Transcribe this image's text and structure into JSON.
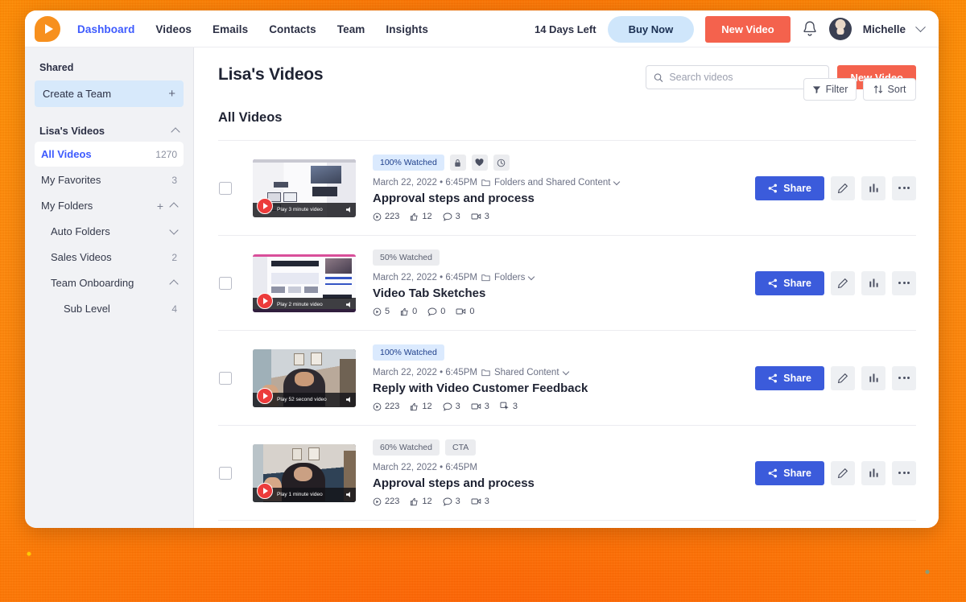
{
  "topnav": {
    "logo": "vidyard-play-logo",
    "links": [
      {
        "label": "Dashboard",
        "active": true
      },
      {
        "label": "Videos",
        "active": false
      },
      {
        "label": "Emails",
        "active": false
      },
      {
        "label": "Contacts",
        "active": false
      },
      {
        "label": "Team",
        "active": false
      },
      {
        "label": "Insights",
        "active": false
      }
    ],
    "days_left": "14 Days Left",
    "buy_now": "Buy Now",
    "new_video": "New Video",
    "user_name": "Michelle"
  },
  "sidebar": {
    "shared_heading": "Shared",
    "create_team": "Create a Team",
    "group_label": "Lisa's Videos",
    "items": [
      {
        "label": "All Videos",
        "count": "1270",
        "selected": true,
        "indent": 0
      },
      {
        "label": "My Favorites",
        "count": "3",
        "selected": false,
        "indent": 0
      },
      {
        "label": "My Folders",
        "count": "",
        "selected": false,
        "indent": 0
      },
      {
        "label": "Auto Folders",
        "count": "",
        "selected": false,
        "indent": 1
      },
      {
        "label": "Sales Videos",
        "count": "2",
        "selected": false,
        "indent": 1
      },
      {
        "label": "Team Onboarding",
        "count": "",
        "selected": false,
        "indent": 1
      },
      {
        "label": "Sub Level",
        "count": "4",
        "selected": false,
        "indent": 2
      }
    ]
  },
  "main": {
    "page_title": "Lisa's Videos",
    "section_title": "All Videos",
    "search_placeholder": "Search videos",
    "search_value": "",
    "new_video_button": "New Video",
    "filter_button": "Filter",
    "sort_button": "Sort",
    "share_label": "Share"
  },
  "colors": {
    "brand_orange": "#F7901E",
    "accent_red": "#F4624D",
    "accent_blue": "#3D5AFE",
    "share_blue": "#3B5BDB",
    "badge_blue_bg": "#DBEAFE",
    "badge_grey_bg": "#EBECEF",
    "sidebar_bg": "#F1F2F5",
    "backdrop": "#FF8C00"
  },
  "videos": [
    {
      "badge": "100% Watched",
      "badge_style": "blue",
      "chips": [
        "lock-icon",
        "heart-icon",
        "clock-icon"
      ],
      "extra_badge": "",
      "date": "March 22, 2022 • 6:45PM",
      "folder": "Folders and Shared Content",
      "has_folder": true,
      "title": "Approval steps and process",
      "play_label": "Play 3 minute video",
      "thumb_kind": "screenshare",
      "stats": [
        {
          "icon": "views-icon",
          "value": "223"
        },
        {
          "icon": "thumbs-up-icon",
          "value": "12"
        },
        {
          "icon": "comment-icon",
          "value": "3"
        },
        {
          "icon": "video-reply-icon",
          "value": "3"
        }
      ]
    },
    {
      "badge": "50% Watched",
      "badge_style": "grey",
      "chips": [],
      "extra_badge": "",
      "date": "March 22, 2022 • 6:45PM",
      "folder": "Folders",
      "has_folder": true,
      "title": "Video Tab Sketches",
      "play_label": "Play 2 minute video",
      "thumb_kind": "wireframe",
      "stats": [
        {
          "icon": "views-icon",
          "value": "5"
        },
        {
          "icon": "thumbs-up-icon",
          "value": "0"
        },
        {
          "icon": "comment-icon",
          "value": "0"
        },
        {
          "icon": "video-reply-icon",
          "value": "0"
        }
      ]
    },
    {
      "badge": "100% Watched",
      "badge_style": "blue",
      "chips": [],
      "extra_badge": "",
      "date": "March 22, 2022 • 6:45PM",
      "folder": "Shared Content",
      "has_folder": true,
      "title": "Reply with Video Customer Feedback",
      "play_label": "Play 52 second video",
      "thumb_kind": "webcam-a",
      "stats": [
        {
          "icon": "views-icon",
          "value": "223"
        },
        {
          "icon": "thumbs-up-icon",
          "value": "12"
        },
        {
          "icon": "comment-icon",
          "value": "3"
        },
        {
          "icon": "video-reply-icon",
          "value": "3"
        },
        {
          "icon": "cta-click-icon",
          "value": "3"
        }
      ]
    },
    {
      "badge": "60% Watched",
      "badge_style": "grey",
      "chips": [],
      "extra_badge": "CTA",
      "date": "March 22, 2022 • 6:45PM",
      "folder": "",
      "has_folder": false,
      "title": "Approval steps and process",
      "play_label": "Play 1 minute video",
      "thumb_kind": "webcam-b",
      "stats": [
        {
          "icon": "views-icon",
          "value": "223"
        },
        {
          "icon": "thumbs-up-icon",
          "value": "12"
        },
        {
          "icon": "comment-icon",
          "value": "3"
        },
        {
          "icon": "video-reply-icon",
          "value": "3"
        }
      ]
    }
  ]
}
